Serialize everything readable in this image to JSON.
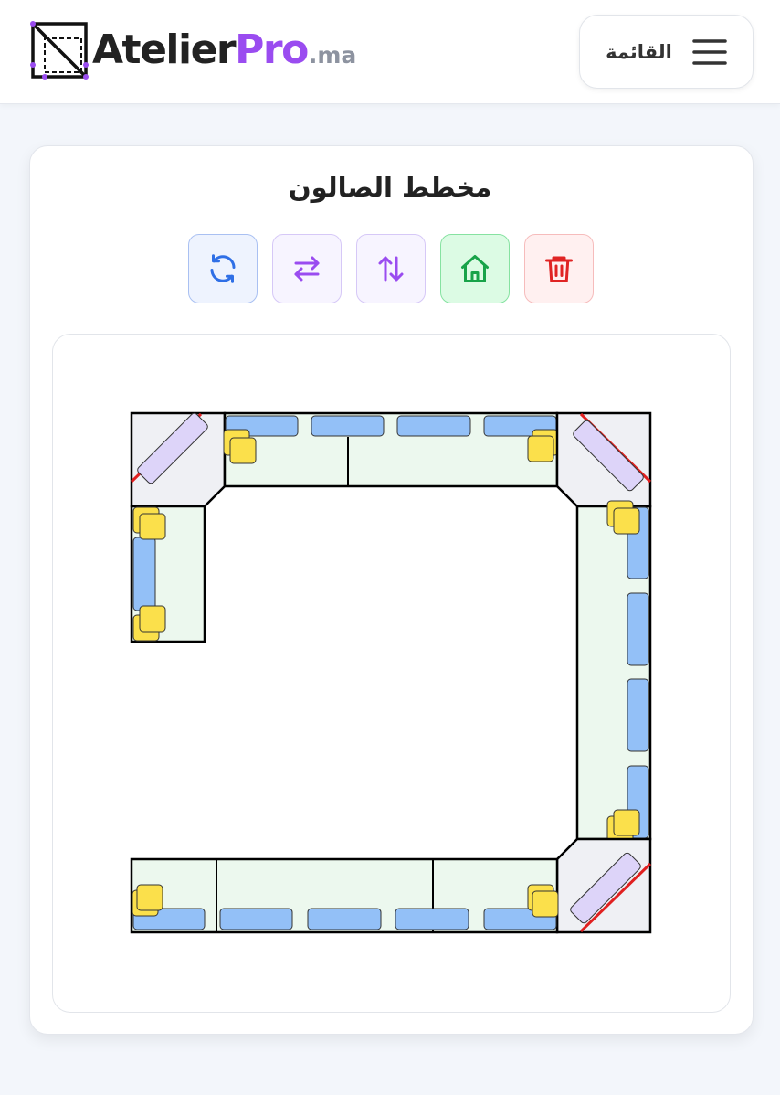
{
  "header": {
    "logo": {
      "part1": "Atelier",
      "part2": "Pro",
      "suffix": ".ma"
    },
    "menu_label": "القائمة"
  },
  "card": {
    "title": "مخطط الصالون"
  },
  "toolbar": {
    "rotate_icon": "rotate-icon",
    "swap_horizontal_icon": "swap-horizontal-icon",
    "swap_vertical_icon": "swap-vertical-icon",
    "home_icon": "home-icon",
    "delete_icon": "trash-icon"
  },
  "colors": {
    "brand_purple": "#9a4cf0",
    "seat_fill": "#ecf8ee",
    "corner_fill": "#eff0f4",
    "cushion_blue": "#93c0f7",
    "pillow_yellow": "#fbe04b",
    "corner_cushion_purple": "#ddd4f9",
    "corner_edge_red": "#e02020",
    "outline": "#000000"
  },
  "plan": {
    "type": "U-shaped salon layout",
    "corner_pieces": 3,
    "left_wing_segments": 1,
    "top_segments": 2,
    "right_segments": 1,
    "bottom_segments": 3
  }
}
